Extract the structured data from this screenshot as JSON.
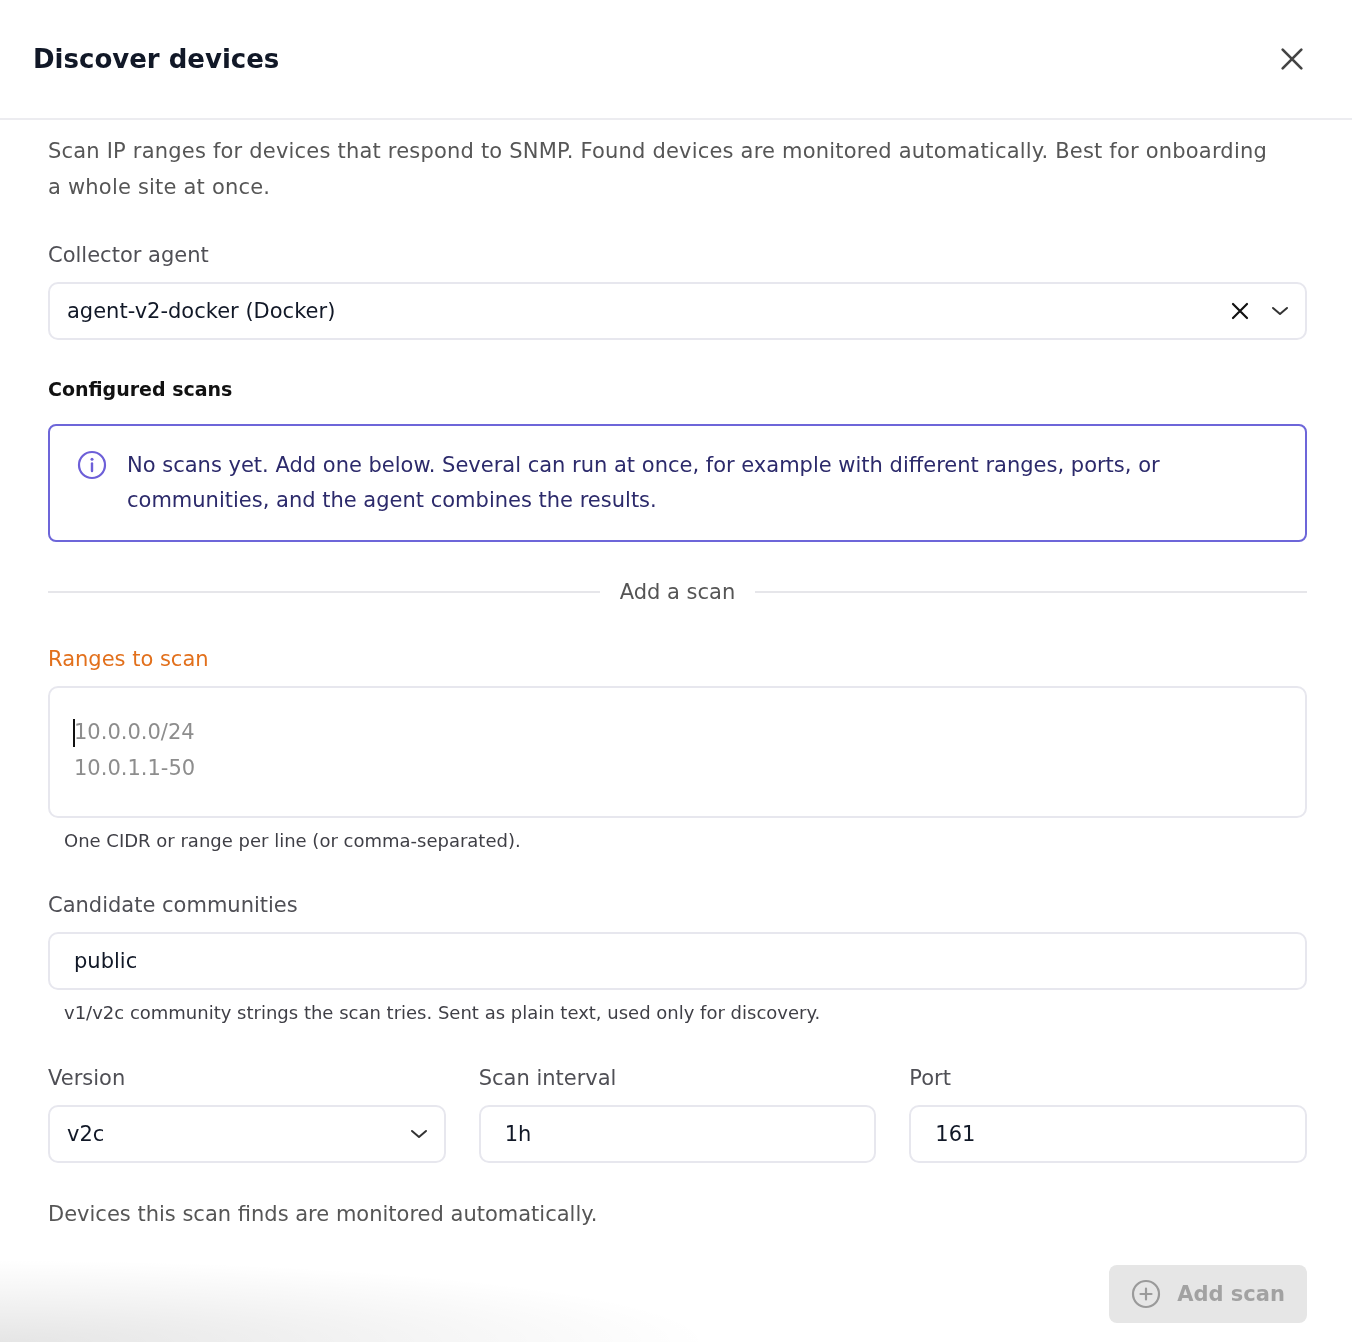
{
  "dialog": {
    "title": "Discover devices"
  },
  "description": "Scan IP ranges for devices that respond to SNMP. Found devices are monitored automatically. Best for onboarding a whole site at once.",
  "collector_agent": {
    "label": "Collector agent",
    "value": "agent-v2-docker (Docker)"
  },
  "configured_scans": {
    "heading": "Configured scans",
    "notice": "No scans yet. Add one below. Several can run at once, for example with different ranges, ports, or communities, and the agent combines the results."
  },
  "add_scan": {
    "divider_label": "Add a scan",
    "ranges": {
      "label": "Ranges to scan",
      "placeholder": "10.0.0.0/24\n10.0.1.1-50",
      "hint": "One CIDR or range per line (or comma-separated).",
      "focused": true
    },
    "communities": {
      "label": "Candidate communities",
      "value": "public",
      "hint": "v1/v2c community strings the scan tries. Sent as plain text, used only for discovery."
    },
    "fields": [
      {
        "kind": "select",
        "label": "Version",
        "value": "v2c"
      },
      {
        "kind": "text",
        "label": "Scan interval",
        "value": "1h"
      },
      {
        "kind": "text",
        "label": "Port",
        "value": "161"
      }
    ],
    "note": "Devices this scan finds are monitored automatically.",
    "button": {
      "label": "Add scan",
      "disabled": true
    }
  }
}
